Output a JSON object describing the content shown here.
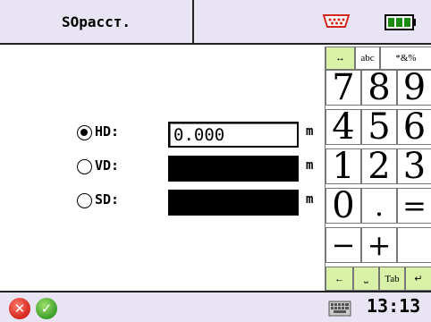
{
  "header": {
    "title": "SOрасст.",
    "connection_icon": "serial-connector-icon",
    "battery_icon": "battery-full-icon",
    "battery_color": "#1d8a12"
  },
  "form": {
    "selected": "HD",
    "rows": [
      {
        "label": "HD:",
        "value": "0.000",
        "unit": "m"
      },
      {
        "label": "VD:",
        "value": "",
        "unit": "m"
      },
      {
        "label": "SD:",
        "value": "",
        "unit": "m"
      }
    ]
  },
  "keypad": {
    "modes": [
      "↔",
      "abc",
      "*&%"
    ],
    "keys": [
      "7",
      "8",
      "9",
      "4",
      "5",
      "6",
      "1",
      "2",
      "3",
      "0",
      ".",
      "=",
      "−",
      "+",
      ""
    ],
    "bottom": [
      "←",
      "⎵",
      "Tab",
      "↵"
    ],
    "accent": "#d9f2a8"
  },
  "footer": {
    "cancel_icon": "cancel-icon",
    "ok_icon": "ok-icon",
    "keyboard_icon": "keyboard-icon",
    "time": "13:13"
  }
}
